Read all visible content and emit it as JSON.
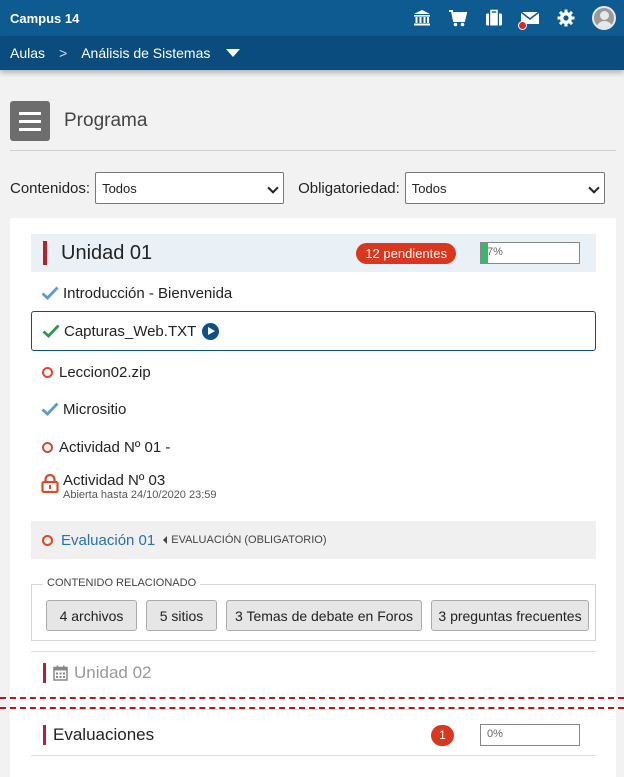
{
  "header": {
    "brand": "Campus 14"
  },
  "breadcrumb": {
    "root": "Aulas",
    "sep": ">",
    "course": "Análisis de Sistemas"
  },
  "page": {
    "title": "Programa"
  },
  "filters": {
    "contents_label": "Contenidos:",
    "contents_value": "Todos",
    "required_label": "Obligatoriedad:",
    "required_value": "Todos"
  },
  "unit1": {
    "title": "Unidad 01",
    "pending": "12 pendientes",
    "progress_text": "7%",
    "progress_value": 0.07,
    "items": [
      {
        "label": "Introducción - Bienvenida",
        "status": "done"
      },
      {
        "label": "Capturas_Web.TXT",
        "status": "done-selected"
      },
      {
        "label": "Leccion02.zip",
        "status": "pending"
      },
      {
        "label": "Micrositio",
        "status": "done"
      },
      {
        "label": "Actividad Nº 01 -",
        "status": "pending"
      },
      {
        "label": "Actividad Nº 03",
        "status": "locked",
        "sub": "Abierta hasta 24/10/2020 23:59"
      }
    ],
    "evaluation": {
      "label": "Evaluación 01",
      "type": "EVALUACIÓN (OBLIGATORIO)"
    }
  },
  "related": {
    "legend": "CONTENIDO RELACIONADO",
    "buttons": [
      "4 archivos",
      "5 sitios",
      "3 Temas de debate en Foros",
      "3 preguntas frecuentes"
    ]
  },
  "unit2": {
    "title": "Unidad 02"
  },
  "evaluations": {
    "title": "Evaluaciones",
    "count": "1",
    "progress_text": "0%",
    "progress_value": 0
  },
  "colors": {
    "topbar": "#0e5b92",
    "crumbbar": "#0a4c7d",
    "accent_red": "#b2232a",
    "badge": "#d9381e",
    "progress": "#37b86b",
    "link": "#2a6fb0"
  },
  "icons": [
    "bank-icon",
    "cart-icon",
    "briefcase-icon",
    "mail-icon",
    "gear-icon",
    "avatar",
    "menu-icon",
    "check-icon",
    "ring-icon",
    "lock-icon",
    "play-icon",
    "calendar-icon",
    "chevron-down-icon"
  ]
}
